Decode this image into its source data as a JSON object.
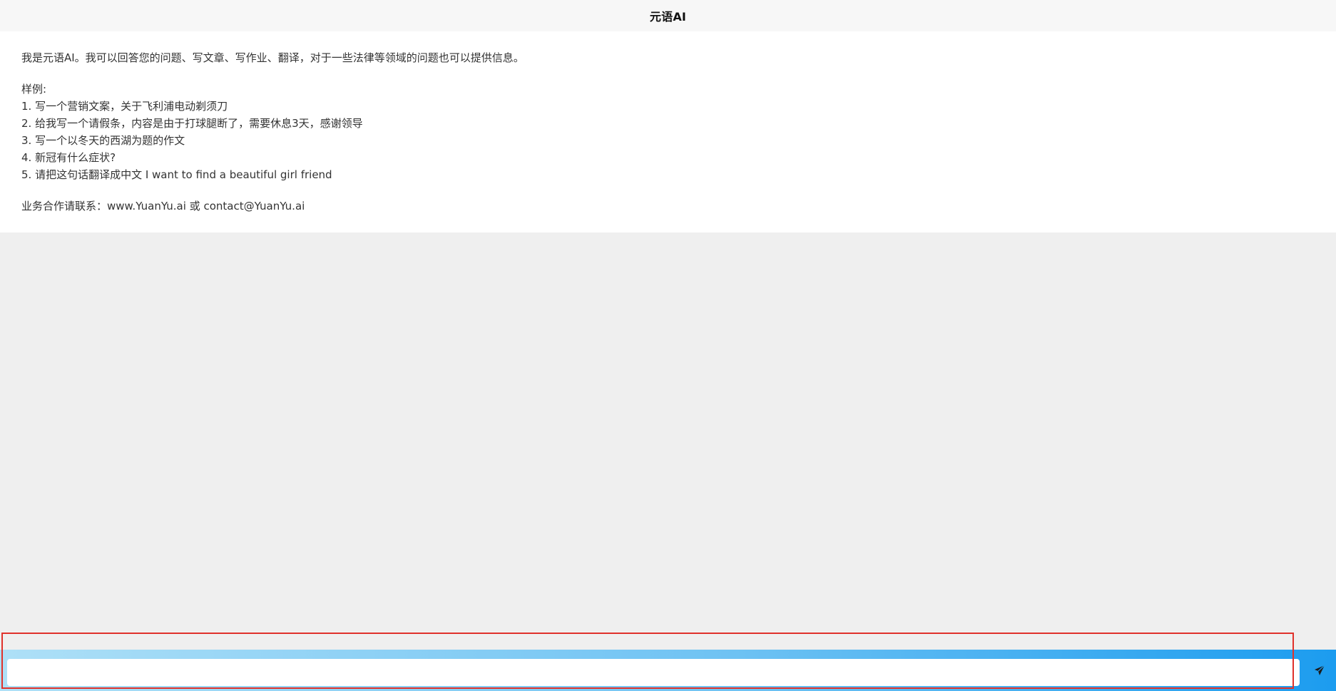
{
  "header": {
    "title": "元语AI"
  },
  "welcome_message": {
    "intro": "我是元语AI。我可以回答您的问题、写文章、写作业、翻译，对于一些法律等领域的问题也可以提供信息。",
    "examples_heading": "样例:",
    "examples": [
      "1. 写一个营销文案，关于飞利浦电动剃须刀",
      "2. 给我写一个请假条，内容是由于打球腿断了，需要休息3天，感谢领导",
      "3. 写一个以冬天的西湖为题的作文",
      "4. 新冠有什么症状?",
      "5. 请把这句话翻译成中文 I want to find a beautiful girl friend"
    ],
    "contact": "业务合作请联系：www.YuanYu.ai 或 contact@YuanYu.ai"
  },
  "input_bar": {
    "input_value": "",
    "placeholder": "",
    "send_icon": "paper-plane-icon",
    "highlight_color": "#e0322b",
    "gradient_end_color": "#1c9cef"
  }
}
